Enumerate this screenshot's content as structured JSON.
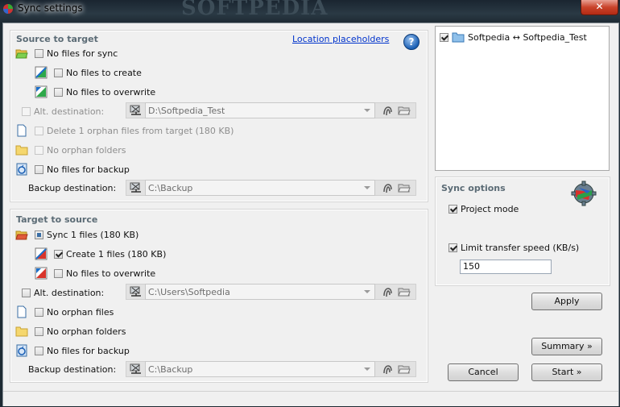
{
  "window": {
    "title": "Sync settings",
    "watermark": "SOFTPEDIA",
    "close_label": "✕"
  },
  "source_to_target": {
    "title": "Source to target",
    "location_link": "Location placeholders",
    "help_label": "?",
    "no_files_for_sync": "No files for sync",
    "no_files_to_create": "No files to create",
    "no_files_to_overwrite": "No files to overwrite",
    "alt_destination_label": "Alt. destination:",
    "alt_destination_value": "D:\\Softpedia_Test",
    "delete_orphan": "Delete 1 orphan files from target (180 KB)",
    "no_orphan_folders": "No orphan folders",
    "no_files_for_backup": "No files for backup",
    "backup_destination_label": "Backup destination:",
    "backup_destination_value": "C:\\Backup"
  },
  "target_to_source": {
    "title": "Target to source",
    "sync_files": "Sync 1 files (180 KB)",
    "create_files": "Create 1 files (180 KB)",
    "no_files_to_overwrite": "No files to overwrite",
    "alt_destination_label": "Alt. destination:",
    "alt_destination_value": "C:\\Users\\Softpedia",
    "no_orphan_files": "No orphan files",
    "no_orphan_folders": "No orphan folders",
    "no_files_for_backup": "No files for backup",
    "backup_destination_label": "Backup destination:",
    "backup_destination_value": "C:\\Backup"
  },
  "pairs": {
    "items": [
      {
        "label": "Softpedia ↔ Softpedia_Test",
        "checked": true
      }
    ]
  },
  "sync_options": {
    "title": "Sync options",
    "project_mode": "Project mode",
    "limit_speed": "Limit transfer speed (KB/s)",
    "speed_value": "150"
  },
  "buttons": {
    "apply": "Apply",
    "summary": "Summary »",
    "cancel": "Cancel",
    "start": "Start »"
  },
  "colors": {
    "group_title": "#5b6b75",
    "link": "#0033cc",
    "close": "#c9432a"
  }
}
